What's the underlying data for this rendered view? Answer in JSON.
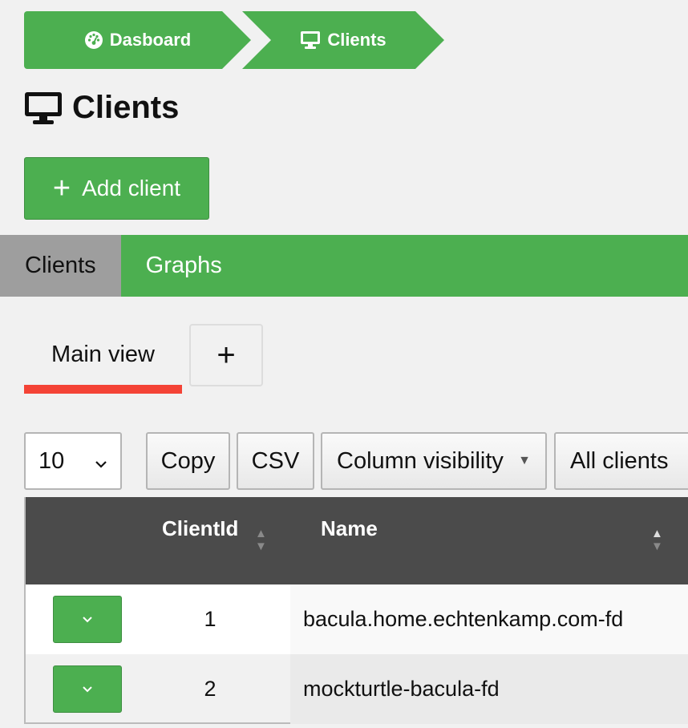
{
  "breadcrumb": {
    "items": [
      {
        "label": "Dasboard",
        "icon": "dashboard-icon"
      },
      {
        "label": "Clients",
        "icon": "desktop-icon"
      }
    ]
  },
  "page": {
    "title": "Clients",
    "icon": "desktop-icon"
  },
  "actions": {
    "add_client_label": "Add client"
  },
  "tabs": [
    {
      "label": "Clients",
      "active": true
    },
    {
      "label": "Graphs",
      "active": false
    }
  ],
  "views": {
    "main_view_label": "Main view",
    "add_view_symbol": "+"
  },
  "toolbar": {
    "page_length": "10",
    "copy_label": "Copy",
    "csv_label": "CSV",
    "column_visibility_label": "Column visibility",
    "filter_label": "All clients"
  },
  "table": {
    "columns": [
      "ClientId",
      "Name"
    ],
    "rows": [
      {
        "id": "1",
        "name": "bacula.home.echtenkamp.com-fd"
      },
      {
        "id": "2",
        "name": "mockturtle-bacula-fd"
      }
    ]
  },
  "colors": {
    "accent": "#4caf50",
    "tab_active": "#9e9e9e",
    "view_underline": "#f44336",
    "header": "#4b4b4b"
  }
}
